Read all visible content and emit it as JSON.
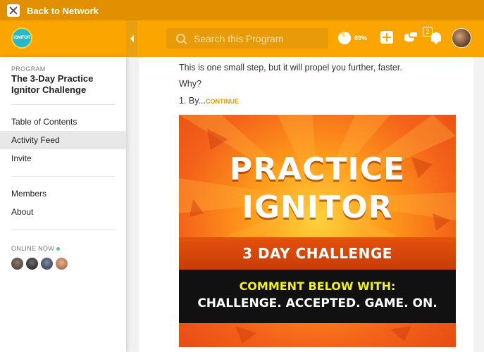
{
  "network_bar": {
    "back_label": "Back to Network"
  },
  "header": {
    "search_placeholder": "Search this Program",
    "progress_percent": 89,
    "progress_label": "89%",
    "notification_count": "2",
    "logo_text": "IGNITOR"
  },
  "sidebar": {
    "program_label": "PROGRAM",
    "program_title": "The 3-Day Practice Ignitor Challenge",
    "nav_primary": [
      "Table of Contents",
      "Activity Feed",
      "Invite"
    ],
    "nav_secondary": [
      "Members",
      "About"
    ],
    "active_item": "Activity Feed",
    "online_label": "ONLINE NOW"
  },
  "post": {
    "line1": "This is one small step, but it will propel you further, faster.",
    "line2": "Why?",
    "line3": "1. By...",
    "continue_label": "CONTINUE"
  },
  "banner": {
    "title_line1": "PRACTICE",
    "title_line2": "IGNITOR",
    "subtitle": "3 DAY CHALLENGE",
    "cta_line1": "COMMENT BELOW WITH:",
    "cta_line2": "CHALLENGE. ACCEPTED. GAME. ON."
  },
  "colors": {
    "brand": "#fba500",
    "brand_dark": "#e09000",
    "accent_link": "#e79a00"
  },
  "icons": [
    "x-logo-icon",
    "collapse-arrow-icon",
    "search-icon",
    "progress-pie-icon",
    "plus-icon",
    "chat-icon",
    "bell-icon"
  ]
}
